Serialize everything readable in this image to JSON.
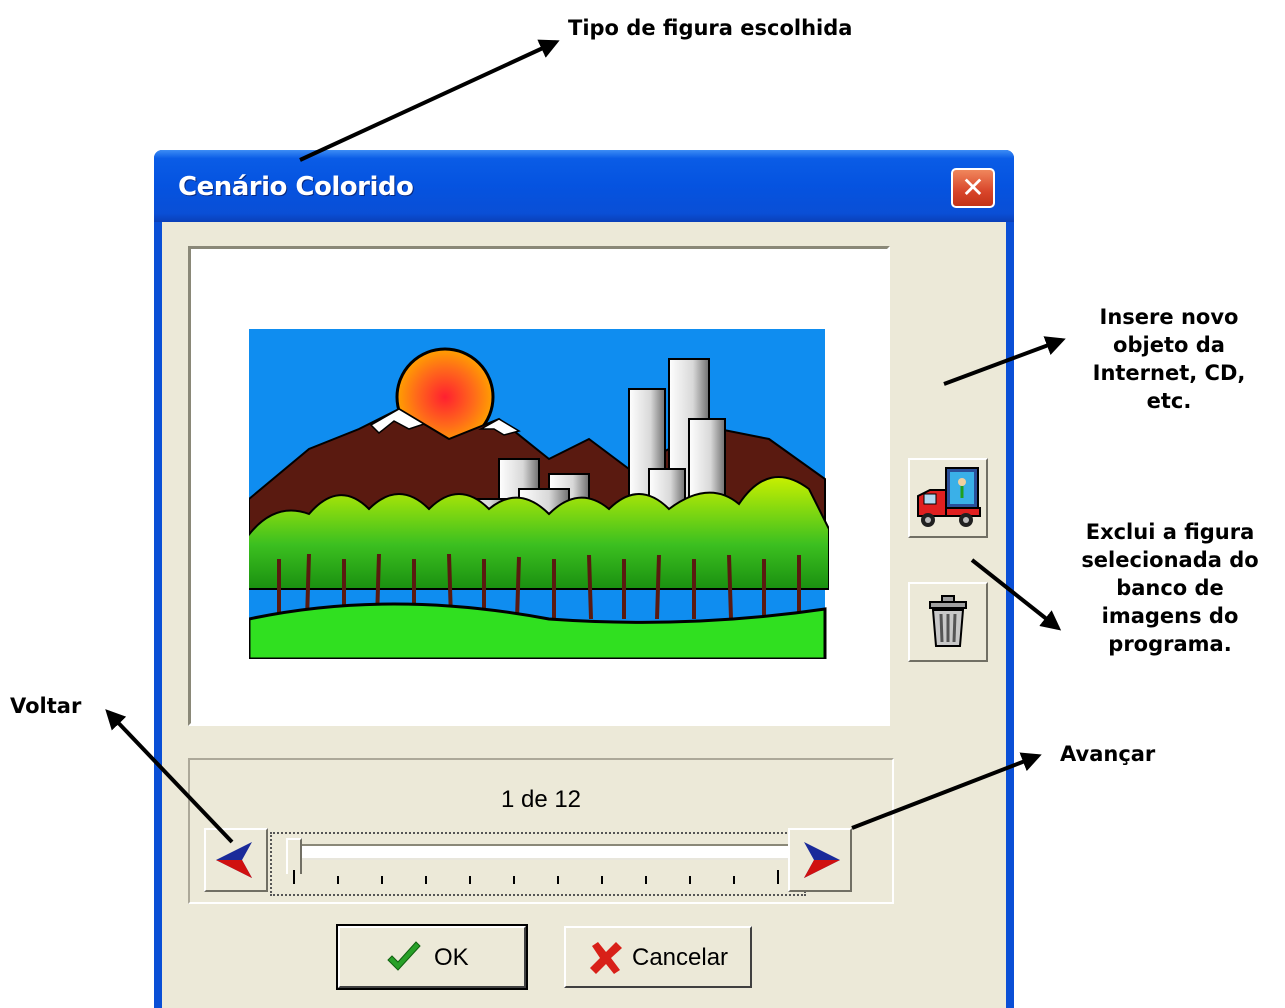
{
  "annotations": {
    "tipo_figura": "Tipo de figura escolhida",
    "insere_line1": "Insere novo",
    "insere_line2": "objeto da",
    "insere_line3": "Internet, CD,",
    "insere_line4": "etc.",
    "exclui_line1": "Exclui a figura",
    "exclui_line2": "selecionada do",
    "exclui_line3": "banco de",
    "exclui_line4": "imagens do",
    "exclui_line5": "programa.",
    "voltar": "Voltar",
    "avancar": "Avançar"
  },
  "window": {
    "title": "Cenário Colorido",
    "close_glyph": "✕"
  },
  "navigation": {
    "counter": "1 de 12",
    "current": 1,
    "total": 12
  },
  "buttons": {
    "ok": "OK",
    "cancel": "Cancelar"
  },
  "colors": {
    "title_bar": "#0a4fd6",
    "client": "#ece9d8",
    "close": "#d8452a"
  }
}
